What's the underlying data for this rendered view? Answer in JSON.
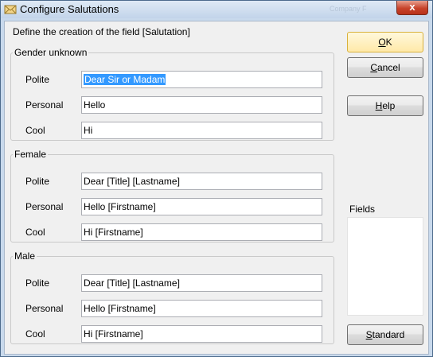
{
  "window": {
    "title": "Configure Salutations",
    "ghost_title": "Company F",
    "close_glyph": "x"
  },
  "heading": "Define the creation of the field [Salutation]",
  "groups": [
    {
      "legend": "Gender unknown",
      "rows": [
        {
          "label": "Polite",
          "value": "Dear Sir or Madam",
          "selected": true
        },
        {
          "label": "Personal",
          "value": "Hello"
        },
        {
          "label": "Cool",
          "value": "Hi"
        }
      ]
    },
    {
      "legend": "Female",
      "rows": [
        {
          "label": "Polite",
          "value": "Dear [Title] [Lastname]"
        },
        {
          "label": "Personal",
          "value": "Hello [Firstname]"
        },
        {
          "label": "Cool",
          "value": "Hi [Firstname]"
        }
      ]
    },
    {
      "legend": "Male",
      "rows": [
        {
          "label": "Polite",
          "value": "Dear [Title] [Lastname]"
        },
        {
          "label": "Personal",
          "value": "Hello [Firstname]"
        },
        {
          "label": "Cool",
          "value": "Hi [Firstname]"
        }
      ]
    }
  ],
  "buttons": {
    "ok": {
      "mnemonic": "O",
      "rest": "K"
    },
    "cancel": {
      "mnemonic": "C",
      "rest": "ancel"
    },
    "help": {
      "mnemonic": "H",
      "rest": "elp"
    },
    "standard": {
      "mnemonic": "S",
      "rest": "tandard"
    }
  },
  "fields": {
    "label": "Fields",
    "items": []
  },
  "icons": {
    "title_icon": "envelope-icon",
    "close": "close-icon"
  },
  "colors": {
    "default_button": "#ffe9a8",
    "selection": "#3399ff",
    "close": "#c7432b"
  }
}
